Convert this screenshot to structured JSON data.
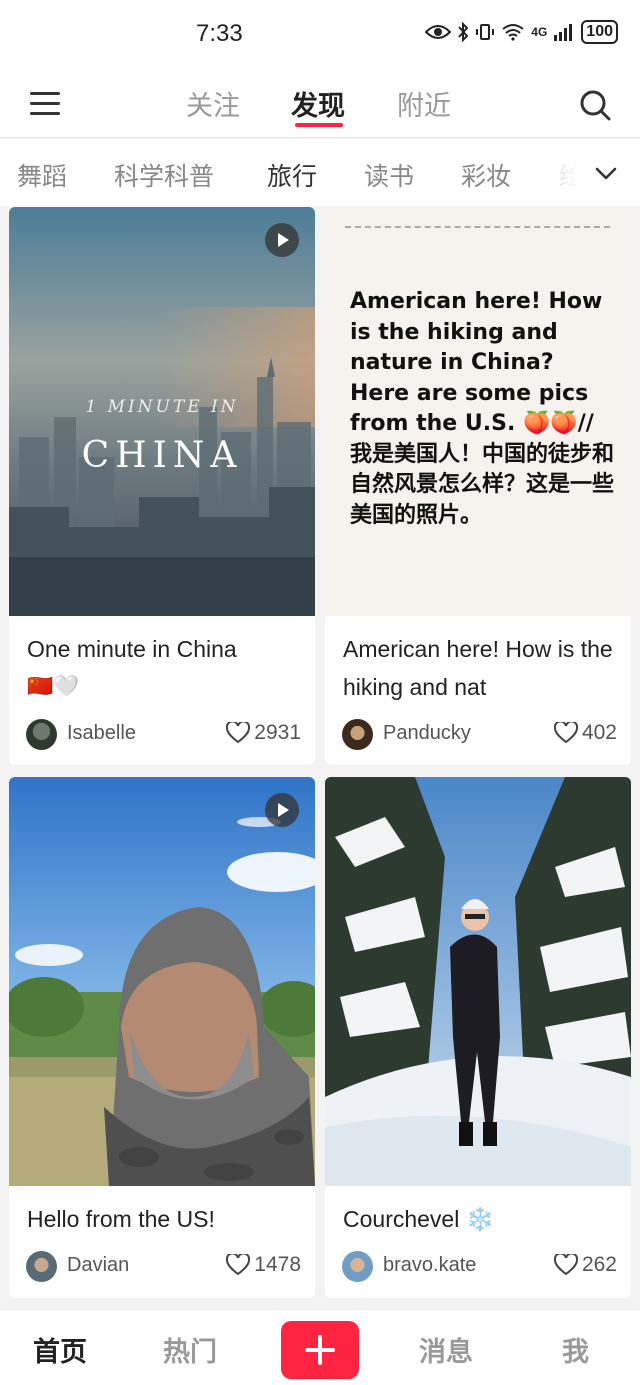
{
  "status_bar": {
    "time": "7:33",
    "network": "4G",
    "battery": "100"
  },
  "top_nav": {
    "tabs": [
      {
        "label": "关注"
      },
      {
        "label": "发现"
      },
      {
        "label": "附近"
      }
    ],
    "active_tab": "发现"
  },
  "categories": [
    {
      "label": "舞蹈"
    },
    {
      "label": "科学科普"
    },
    {
      "label": "旅行"
    },
    {
      "label": "读书"
    },
    {
      "label": "彩妆"
    },
    {
      "label": "绘"
    }
  ],
  "active_category": "旅行",
  "feed": [
    {
      "thumb_text_line1": "1 MINUTE IN",
      "thumb_text_line2": "CHINA",
      "title": "One minute in China",
      "title_emoji": "🇨🇳🤍",
      "author": "Isabelle",
      "likes": "2931",
      "is_video": true
    },
    {
      "thumb_text": "American here! How is the hiking and nature in China? Here are some pics from the U.S. 🍑🍑// 我是美国人！中国的徒步和自然风景怎么样？这是一些美国的照片。",
      "title": "American here! How is the hiking and nat",
      "author": "Panducky",
      "likes": "402",
      "is_video": false
    },
    {
      "title": "Hello from the US!",
      "author": "Davian",
      "likes": "1478",
      "is_video": true
    },
    {
      "title": "Courchevel ❄️",
      "author": "bravo.kate",
      "likes": "262",
      "is_video": false
    }
  ],
  "bottom_nav": {
    "items": [
      {
        "label": "首页"
      },
      {
        "label": "热门"
      },
      {
        "label": "消息"
      },
      {
        "label": "我"
      }
    ],
    "active": "首页"
  },
  "colors": {
    "accent": "#ff2442",
    "background": "#f3f3f3"
  }
}
